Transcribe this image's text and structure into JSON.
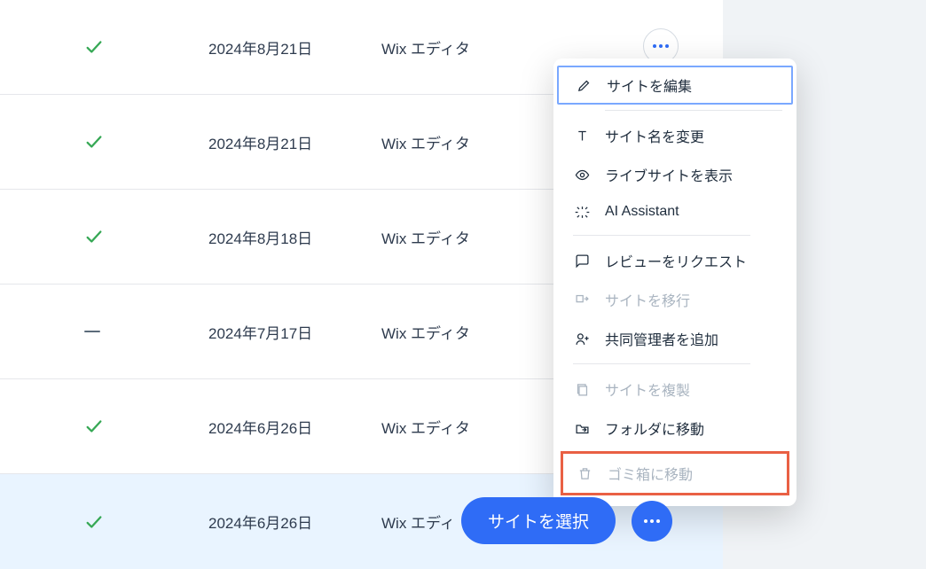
{
  "rows": [
    {
      "status": "check",
      "date": "2024年8月21日",
      "editor": "Wix エディタ"
    },
    {
      "status": "check",
      "date": "2024年8月21日",
      "editor": "Wix エディタ"
    },
    {
      "status": "check",
      "date": "2024年8月18日",
      "editor": "Wix エディタ"
    },
    {
      "status": "dash",
      "date": "2024年7月17日",
      "editor": "Wix エディタ"
    },
    {
      "status": "check",
      "date": "2024年6月26日",
      "editor": "Wix エディタ"
    },
    {
      "status": "check",
      "date": "2024年6月26日",
      "editor": "Wix エディ"
    }
  ],
  "menu": {
    "edit_site": "サイトを編集",
    "rename_site": "サイト名を変更",
    "view_live_site": "ライブサイトを表示",
    "ai_assistant": "AI Assistant",
    "request_review": "レビューをリクエスト",
    "transfer_site": "サイトを移行",
    "add_collaborator": "共同管理者を追加",
    "duplicate_site": "サイトを複製",
    "move_to_folder": "フォルダに移動",
    "move_to_trash": "ゴミ箱に移動"
  },
  "buttons": {
    "select_site": "サイトを選択"
  }
}
